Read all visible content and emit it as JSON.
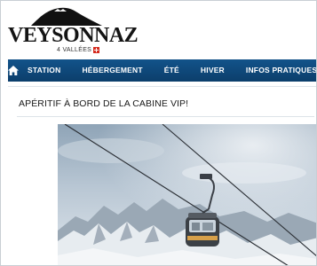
{
  "brand": {
    "name": "VEYSONNAZ",
    "tagline": "4 VALLÉES"
  },
  "nav": {
    "home_icon": "home-icon",
    "items": [
      "STATION",
      "HÉBERGEMENT",
      "ÉTÉ",
      "HIVER",
      "INFOS PRATIQUES"
    ]
  },
  "article": {
    "title": "APÉRITIF À BORD DE LA CABINE VIP!"
  },
  "colors": {
    "nav_bg": "#0f4a7d",
    "swiss_red": "#d52b1e",
    "text": "#1a1a1a"
  }
}
